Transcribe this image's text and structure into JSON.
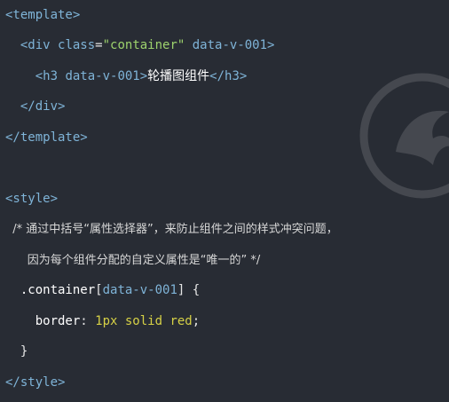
{
  "editor": {
    "lines": [
      {
        "id": "l1",
        "tokens": [
          {
            "t": "<template>",
            "c": "tag"
          }
        ]
      },
      {
        "id": "l2",
        "tokens": [
          {
            "t": "  <div ",
            "c": "tag"
          },
          {
            "t": "class",
            "c": "attr"
          },
          {
            "t": "=",
            "c": "punct"
          },
          {
            "t": "\"container\"",
            "c": "str"
          },
          {
            "t": " data-v-001",
            "c": "attr"
          },
          {
            "t": ">",
            "c": "tag"
          }
        ]
      },
      {
        "id": "l3",
        "tokens": [
          {
            "t": "    <h3 ",
            "c": "tag"
          },
          {
            "t": "data-v-001",
            "c": "attr"
          },
          {
            "t": ">",
            "c": "tag"
          },
          {
            "t": "轮播图组件",
            "c": "text"
          },
          {
            "t": "</h3>",
            "c": "tag"
          }
        ]
      },
      {
        "id": "l4",
        "tokens": [
          {
            "t": "  </div>",
            "c": "tag"
          }
        ]
      },
      {
        "id": "l5",
        "tokens": [
          {
            "t": "</template>",
            "c": "tag"
          }
        ]
      },
      {
        "id": "l6",
        "tokens": []
      },
      {
        "id": "l7",
        "tokens": [
          {
            "t": "<style>",
            "c": "tag"
          }
        ]
      },
      {
        "id": "l8",
        "tokens": [
          {
            "t": "  /* 通过中括号“属性选择器”，来防止组件之间的样式冲突问题，",
            "c": "com"
          }
        ]
      },
      {
        "id": "l9",
        "tokens": [
          {
            "t": "      因为每个组件分配的自定义属性是“唯一的” */",
            "c": "com"
          }
        ]
      },
      {
        "id": "l10",
        "tokens": [
          {
            "t": "  .container",
            "c": "prop"
          },
          {
            "t": "[",
            "c": "punct"
          },
          {
            "t": "data-v-001",
            "c": "attr"
          },
          {
            "t": "] {",
            "c": "punct"
          }
        ]
      },
      {
        "id": "l11",
        "tokens": [
          {
            "t": "    border",
            "c": "prop"
          },
          {
            "t": ": ",
            "c": "punct"
          },
          {
            "t": "1px solid red",
            "c": "val"
          },
          {
            "t": ";",
            "c": "punct"
          }
        ]
      },
      {
        "id": "l12",
        "tokens": [
          {
            "t": "  }",
            "c": "punct"
          }
        ]
      },
      {
        "id": "l13",
        "tokens": [
          {
            "t": "</style>",
            "c": "tag"
          }
        ]
      }
    ]
  }
}
